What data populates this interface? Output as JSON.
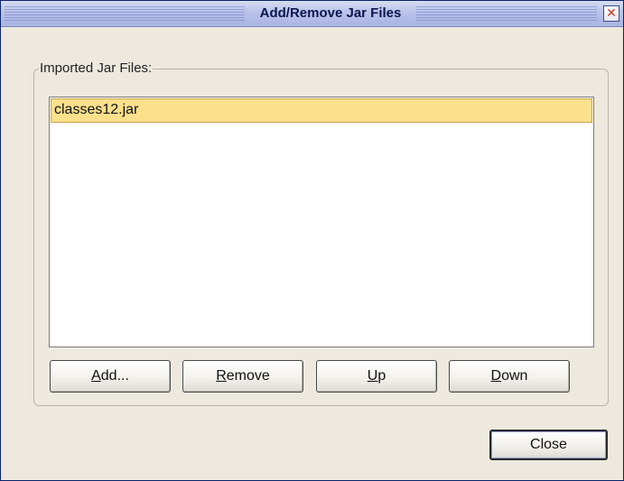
{
  "window": {
    "title": "Add/Remove Jar Files",
    "close_icon": "close-icon"
  },
  "group": {
    "label": "Imported Jar Files:"
  },
  "list": {
    "items": [
      {
        "label": "classes12.jar",
        "selected": true
      }
    ],
    "selected_color": "#fce08c"
  },
  "buttons": {
    "add": {
      "mnemonic": "A",
      "rest": "dd..."
    },
    "remove": {
      "mnemonic": "R",
      "rest": "emove"
    },
    "up": {
      "mnemonic": "U",
      "rest": "p"
    },
    "down": {
      "mnemonic": "D",
      "rest": "own"
    },
    "close": "Close"
  },
  "colors": {
    "titlebar": "#b9c3ea",
    "dialog_background": "#ede9df",
    "title_text": "#0b1650"
  }
}
